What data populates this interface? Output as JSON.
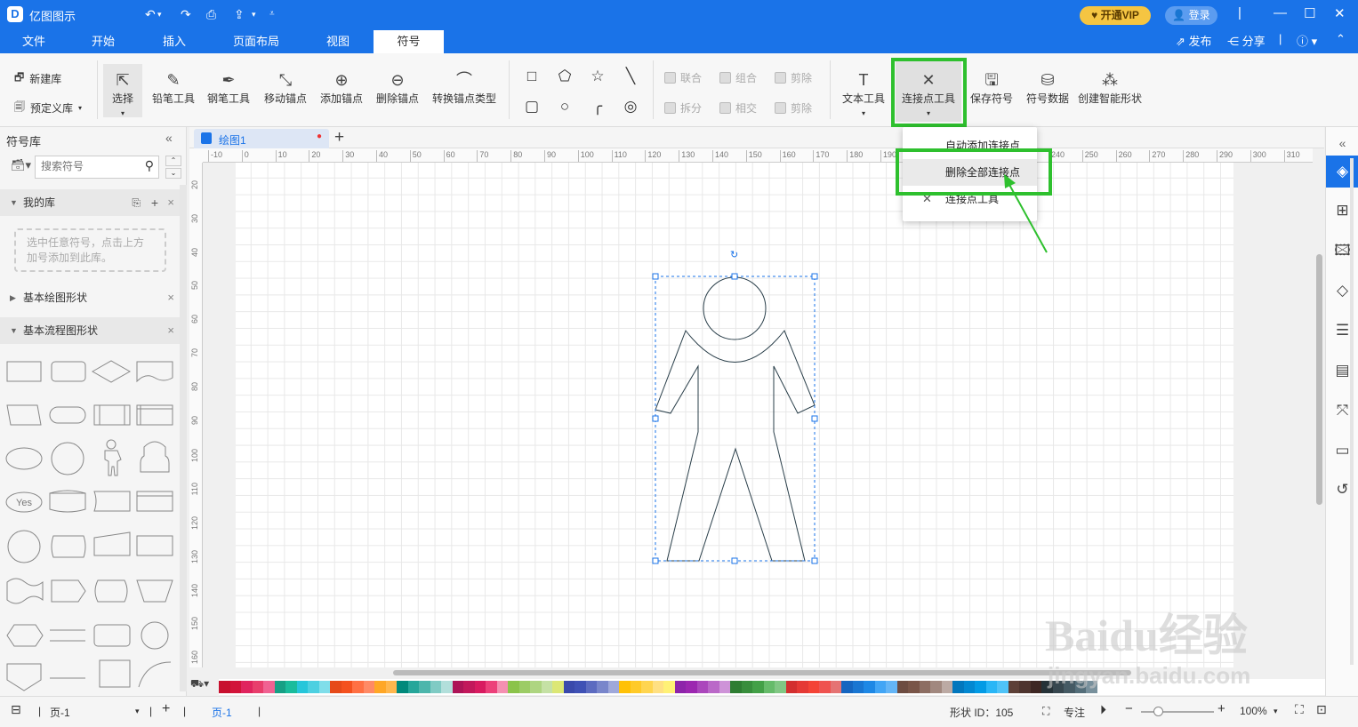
{
  "app": {
    "title": "亿图图示",
    "vip_label": "开通VIP",
    "login_label": "登录"
  },
  "menu": {
    "tabs": [
      "文件",
      "开始",
      "插入",
      "页面布局",
      "视图",
      "符号"
    ],
    "active": "符号",
    "publish": "发布",
    "share": "分享"
  },
  "ribbon": {
    "new_lib": "新建库",
    "predef_lib": "预定义库",
    "tools": [
      "选择",
      "铅笔工具",
      "钢笔工具",
      "移动锚点",
      "添加锚点",
      "删除锚点",
      "转换锚点类型"
    ],
    "bool_ops": [
      "联合",
      "组合",
      "剪除",
      "拆分",
      "相交",
      "剪除"
    ],
    "text_tool": "文本工具",
    "connector_tool": "连接点工具",
    "save_symbol": "保存符号",
    "symbol_data": "符号数据",
    "smart_shape": "创建智能形状"
  },
  "dropdown": {
    "items": [
      "自动添加连接点",
      "删除全部连接点",
      "连接点工具"
    ]
  },
  "sidebar": {
    "title": "符号库",
    "search_placeholder": "搜索符号",
    "my_lib": "我的库",
    "my_lib_hint": "选中任意符号，点击上方加号添加到此库。",
    "sections": [
      "基本绘图形状",
      "基本流程图形状"
    ],
    "shape_yes": "Yes"
  },
  "document": {
    "tab": "绘图1"
  },
  "ruler": {
    "h": [
      "-10",
      "0",
      "10",
      "20",
      "30",
      "40",
      "50",
      "60",
      "70",
      "80",
      "90",
      "100",
      "110",
      "120",
      "130",
      "140",
      "150",
      "160",
      "170",
      "180",
      "190",
      "200",
      "210",
      "220",
      "230",
      "240",
      "250",
      "260",
      "270",
      "280",
      "290",
      "300",
      "310"
    ],
    "v": [
      "20",
      "30",
      "40",
      "50",
      "60",
      "70",
      "80",
      "90",
      "100",
      "110",
      "120",
      "130",
      "140",
      "150",
      "160"
    ]
  },
  "status": {
    "page_select": "页-1",
    "page_tab": "页-1",
    "shape_id": "形状 ID：105",
    "focus": "专注",
    "zoom": "100%"
  },
  "watermark": {
    "brand": "Baidu经验",
    "url": "jingyan.baidu.com"
  },
  "colors": [
    "#c8102e",
    "#d2143a",
    "#e0245e",
    "#e83e6c",
    "#f06292",
    "#16a085",
    "#1abc9c",
    "#26c6da",
    "#4dd0e1",
    "#80deea",
    "#e64a19",
    "#f4511e",
    "#ff7043",
    "#ff8a65",
    "#ffa726",
    "#ffb74d",
    "#00897b",
    "#26a69a",
    "#4db6ac",
    "#80cbc4",
    "#b2dfdb",
    "#ad1457",
    "#c2185b",
    "#d81b60",
    "#ec407a",
    "#f48fb1",
    "#8bc34a",
    "#9ccc65",
    "#aed581",
    "#c5e1a5",
    "#dce775",
    "#3949ab",
    "#3f51b5",
    "#5c6bc0",
    "#7986cb",
    "#9fa8da",
    "#ffc107",
    "#ffca28",
    "#ffd54f",
    "#ffe082",
    "#fff176",
    "#8e24aa",
    "#9c27b0",
    "#ab47bc",
    "#ba68c8",
    "#ce93d8",
    "#2e7d32",
    "#388e3c",
    "#43a047",
    "#66bb6a",
    "#81c784",
    "#d32f2f",
    "#e53935",
    "#f44336",
    "#ef5350",
    "#e57373",
    "#1565c0",
    "#1976d2",
    "#1e88e5",
    "#42a5f5",
    "#64b5f6",
    "#6d4c41",
    "#795548",
    "#8d6e63",
    "#a1887f",
    "#bcaaa4",
    "#0277bd",
    "#0288d1",
    "#039be5",
    "#29b6f6",
    "#4fc3f7",
    "#5d4037",
    "#4e342e",
    "#3e2723",
    "#263238",
    "#37474f",
    "#455a64",
    "#546e7a",
    "#78909c"
  ]
}
